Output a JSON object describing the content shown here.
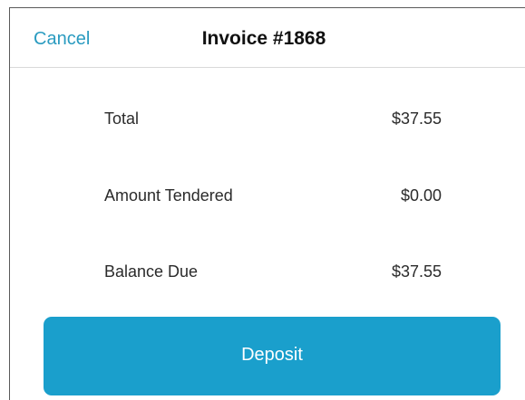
{
  "header": {
    "cancel_label": "Cancel",
    "title": "Invoice #1868"
  },
  "summary": [
    {
      "label": "Total",
      "value": "$37.55"
    },
    {
      "label": "Amount Tendered",
      "value": "$0.00"
    },
    {
      "label": "Balance Due",
      "value": "$37.55"
    }
  ],
  "actions": {
    "deposit_label": "Deposit"
  },
  "colors": {
    "accent": "#1a9fcc",
    "link": "#2a9bc0"
  }
}
